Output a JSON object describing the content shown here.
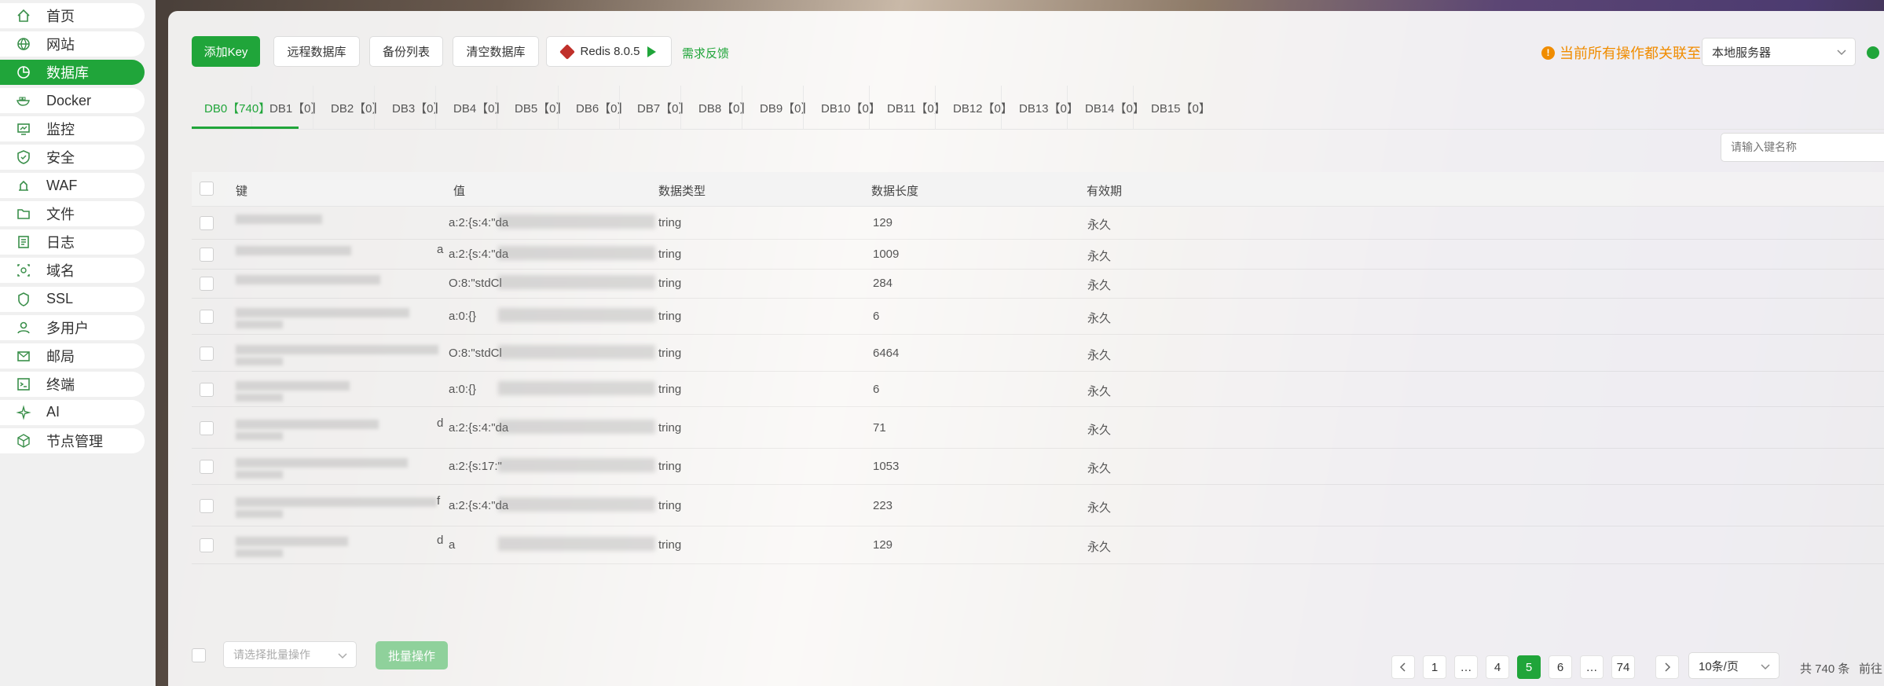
{
  "sidebar": {
    "items": [
      {
        "label": "首页",
        "icon": "home-icon"
      },
      {
        "label": "网站",
        "icon": "globe-icon"
      },
      {
        "label": "数据库",
        "icon": "database-icon",
        "active": true
      },
      {
        "label": "Docker",
        "icon": "docker-icon"
      },
      {
        "label": "监控",
        "icon": "monitor-icon"
      },
      {
        "label": "安全",
        "icon": "shield-icon"
      },
      {
        "label": "WAF",
        "icon": "waf-icon"
      },
      {
        "label": "文件",
        "icon": "folder-icon"
      },
      {
        "label": "日志",
        "icon": "log-icon"
      },
      {
        "label": "域名",
        "icon": "domain-icon"
      },
      {
        "label": "SSL",
        "icon": "ssl-icon"
      },
      {
        "label": "多用户",
        "icon": "user-icon"
      },
      {
        "label": "邮局",
        "icon": "mail-icon"
      },
      {
        "label": "终端",
        "icon": "terminal-icon"
      },
      {
        "label": "AI",
        "icon": "ai-icon"
      },
      {
        "label": "节点管理",
        "icon": "node-icon"
      }
    ]
  },
  "toolbar": {
    "add_key": "添加Key",
    "remote_db": "远程数据库",
    "backup_list": "备份列表",
    "clear_db": "清空数据库",
    "redis_version": "Redis 8.0.5",
    "feedback": "需求反馈",
    "warning_text": "当前所有操作都关联至",
    "server_select": "本地服务器"
  },
  "tabs": [
    "DB0【740】",
    "DB1【0】",
    "DB2【0】",
    "DB3【0】",
    "DB4【0】",
    "DB5【0】",
    "DB6【0】",
    "DB7【0】",
    "DB8【0】",
    "DB9【0】",
    "DB10【0】",
    "DB11【0】",
    "DB12【0】",
    "DB13【0】",
    "DB14【0】",
    "DB15【0】"
  ],
  "search": {
    "placeholder": "请输入键名称"
  },
  "table": {
    "headers": [
      "键",
      "值",
      "数据类型",
      "数据长度",
      "有效期"
    ],
    "rows": [
      {
        "key_tail": "",
        "value": "a:2:{s:4:\"da",
        "type": "tring",
        "length": "129",
        "ttl": "永久"
      },
      {
        "key_tail": "a",
        "value": "a:2:{s:4:\"da",
        "type": "tring",
        "length": "1009",
        "ttl": "永久"
      },
      {
        "key_tail": "",
        "value": "O:8:\"stdCl",
        "type": "tring",
        "length": "284",
        "ttl": "永久"
      },
      {
        "key_tail": "",
        "value": "a:0:{}",
        "type": "tring",
        "length": "6",
        "ttl": "永久"
      },
      {
        "key_tail": "",
        "value": "O:8:\"stdCl",
        "type": "tring",
        "length": "6464",
        "ttl": "永久"
      },
      {
        "key_tail": "",
        "value": "a:0:{}",
        "type": "tring",
        "length": "6",
        "ttl": "永久"
      },
      {
        "key_tail": "d",
        "value": "a:2:{s:4:\"da",
        "type": "tring",
        "length": "71",
        "ttl": "永久"
      },
      {
        "key_tail": "",
        "value": "a:2:{s:17:\"",
        "type": "tring",
        "length": "1053",
        "ttl": "永久"
      },
      {
        "key_tail": "f",
        "value": "a:2:{s:4:\"da",
        "type": "tring",
        "length": "223",
        "ttl": "永久"
      },
      {
        "key_tail": "d",
        "value": "a",
        "type": "tring",
        "length": "129",
        "ttl": "永久"
      }
    ]
  },
  "footer": {
    "batch_placeholder": "请选择批量操作",
    "batch_button": "批量操作",
    "pages": [
      "1",
      "…",
      "4",
      "5",
      "6",
      "…",
      "74"
    ],
    "active_page": "5",
    "page_size": "10条/页",
    "total": "共 740 条",
    "goto": "前往"
  },
  "colors": {
    "accent": "#20a53a",
    "warning": "#f08c00"
  }
}
